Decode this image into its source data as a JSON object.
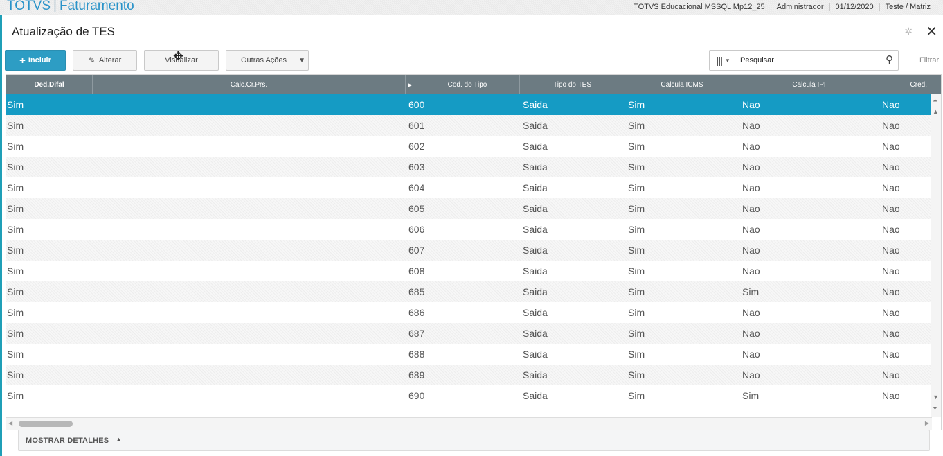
{
  "app": {
    "name": "TOTVS",
    "module": "Faturamento",
    "environment": "TOTVS Educacional MSSQL Mp12_25",
    "user": "Administrador",
    "date": "01/12/2020",
    "branch": "Teste / Matriz"
  },
  "page": {
    "title": "Atualização de TES"
  },
  "toolbar": {
    "incluir": "Incluir",
    "alterar": "Alterar",
    "visualizar": "Visualizar",
    "outras_acoes": "Outras Ações"
  },
  "search": {
    "placeholder": "Pesquisar",
    "value": "",
    "filter_label": "Filtrar"
  },
  "grid": {
    "columns": [
      "Ded.Difal",
      "Calc.Cr.Prs.",
      "",
      "Cod. do Tipo",
      "Tipo do TES",
      "Calcula ICMS",
      "Calcula IPI",
      "Cred."
    ],
    "rows": [
      {
        "ded_difal": "Sim",
        "cod": "600",
        "tipo": "Saida",
        "icms": "Sim",
        "ipi": "Nao",
        "cred": "Nao",
        "selected": true
      },
      {
        "ded_difal": "Sim",
        "cod": "601",
        "tipo": "Saida",
        "icms": "Sim",
        "ipi": "Nao",
        "cred": "Nao"
      },
      {
        "ded_difal": "Sim",
        "cod": "602",
        "tipo": "Saida",
        "icms": "Sim",
        "ipi": "Nao",
        "cred": "Nao"
      },
      {
        "ded_difal": "Sim",
        "cod": "603",
        "tipo": "Saida",
        "icms": "Sim",
        "ipi": "Nao",
        "cred": "Nao"
      },
      {
        "ded_difal": "Sim",
        "cod": "604",
        "tipo": "Saida",
        "icms": "Sim",
        "ipi": "Nao",
        "cred": "Nao"
      },
      {
        "ded_difal": "Sim",
        "cod": "605",
        "tipo": "Saida",
        "icms": "Sim",
        "ipi": "Nao",
        "cred": "Nao"
      },
      {
        "ded_difal": "Sim",
        "cod": "606",
        "tipo": "Saida",
        "icms": "Sim",
        "ipi": "Nao",
        "cred": "Nao"
      },
      {
        "ded_difal": "Sim",
        "cod": "607",
        "tipo": "Saida",
        "icms": "Sim",
        "ipi": "Nao",
        "cred": "Nao"
      },
      {
        "ded_difal": "Sim",
        "cod": "608",
        "tipo": "Saida",
        "icms": "Sim",
        "ipi": "Nao",
        "cred": "Nao"
      },
      {
        "ded_difal": "Sim",
        "cod": "685",
        "tipo": "Saida",
        "icms": "Sim",
        "ipi": "Sim",
        "cred": "Nao"
      },
      {
        "ded_difal": "Sim",
        "cod": "686",
        "tipo": "Saida",
        "icms": "Sim",
        "ipi": "Nao",
        "cred": "Nao"
      },
      {
        "ded_difal": "Sim",
        "cod": "687",
        "tipo": "Saida",
        "icms": "Sim",
        "ipi": "Nao",
        "cred": "Nao"
      },
      {
        "ded_difal": "Sim",
        "cod": "688",
        "tipo": "Saida",
        "icms": "Sim",
        "ipi": "Nao",
        "cred": "Nao"
      },
      {
        "ded_difal": "Sim",
        "cod": "689",
        "tipo": "Saida",
        "icms": "Sim",
        "ipi": "Nao",
        "cred": "Nao"
      },
      {
        "ded_difal": "Sim",
        "cod": "690",
        "tipo": "Saida",
        "icms": "Sim",
        "ipi": "Sim",
        "cred": "Nao"
      }
    ]
  },
  "footer": {
    "details_label": "MOSTRAR DETALHES"
  },
  "colors": {
    "accent": "#2d9dc4",
    "selected_row": "#159bc4",
    "header_bg": "#6c7b82",
    "left_strip": "#1f9fb7"
  },
  "icons": {
    "add": "plus-icon",
    "edit": "pencil-icon",
    "search": "search-icon",
    "close": "close-icon",
    "settings": "gear-icon",
    "columns": "columns-icon"
  }
}
